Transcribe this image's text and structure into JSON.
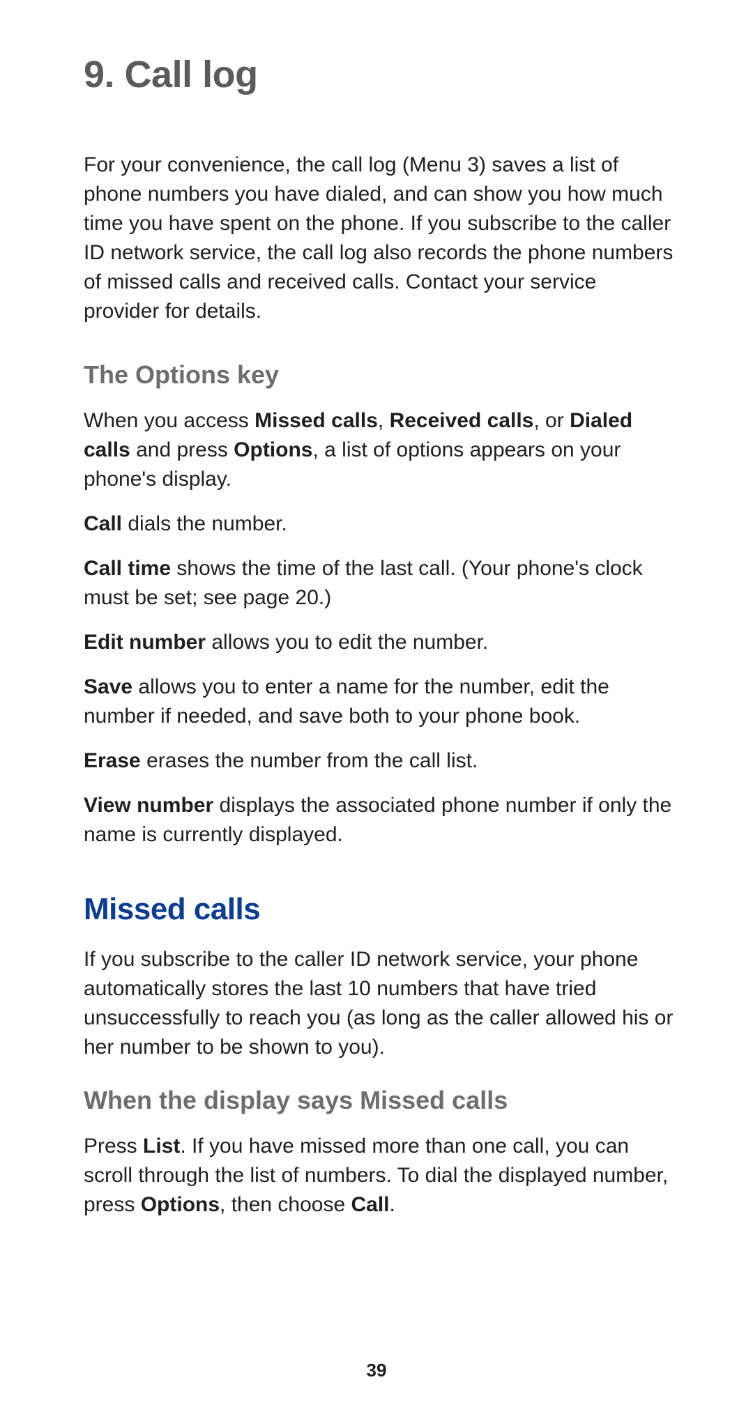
{
  "title": "9. Call log",
  "intro": "For your convenience, the call log (Menu 3) saves a list of phone numbers you have dialed, and can show you how much time you have spent on the phone. If you subscribe to the caller ID network service, the call log also records the phone numbers of missed calls and received calls. Contact your service provider for details.",
  "options_key": {
    "heading": "The Options key",
    "p1_a": "When you access ",
    "p1_b1": "Missed calls",
    "p1_c": ", ",
    "p1_b2": "Received calls",
    "p1_d": ", or ",
    "p1_b3": "Dialed calls",
    "p1_e": " and press ",
    "p1_b4": "Options",
    "p1_f": ", a list of options appears on your phone's display.",
    "call_b": "Call",
    "call_t": " dials the number.",
    "calltime_b": "Call time",
    "calltime_t": " shows the time of the last call. (Your phone's clock must be set; see page 20.)",
    "edit_b": "Edit number",
    "edit_t": " allows you to edit the number.",
    "save_b": "Save",
    "save_t": " allows you to enter a name for the number, edit the number if needed, and save both to your phone book.",
    "erase_b": "Erase",
    "erase_t": " erases the number from the call list.",
    "view_b": "View number",
    "view_t": " displays the associated phone number if only the name is currently displayed."
  },
  "missed": {
    "heading": "Missed calls",
    "intro": "If you subscribe to the caller ID network service, your phone automatically stores the last 10 numbers that have tried unsuccessfully to reach you (as long as the caller allowed his or her number to be shown to you).",
    "sub": "When the display says Missed calls",
    "p_a": "Press ",
    "p_b1": "List",
    "p_c": ". If you have missed more than one call, you can scroll through the list of numbers. To dial the displayed number, press ",
    "p_b2": "Options",
    "p_d": ", then choose ",
    "p_b3": "Call",
    "p_e": "."
  },
  "page_number": "39"
}
